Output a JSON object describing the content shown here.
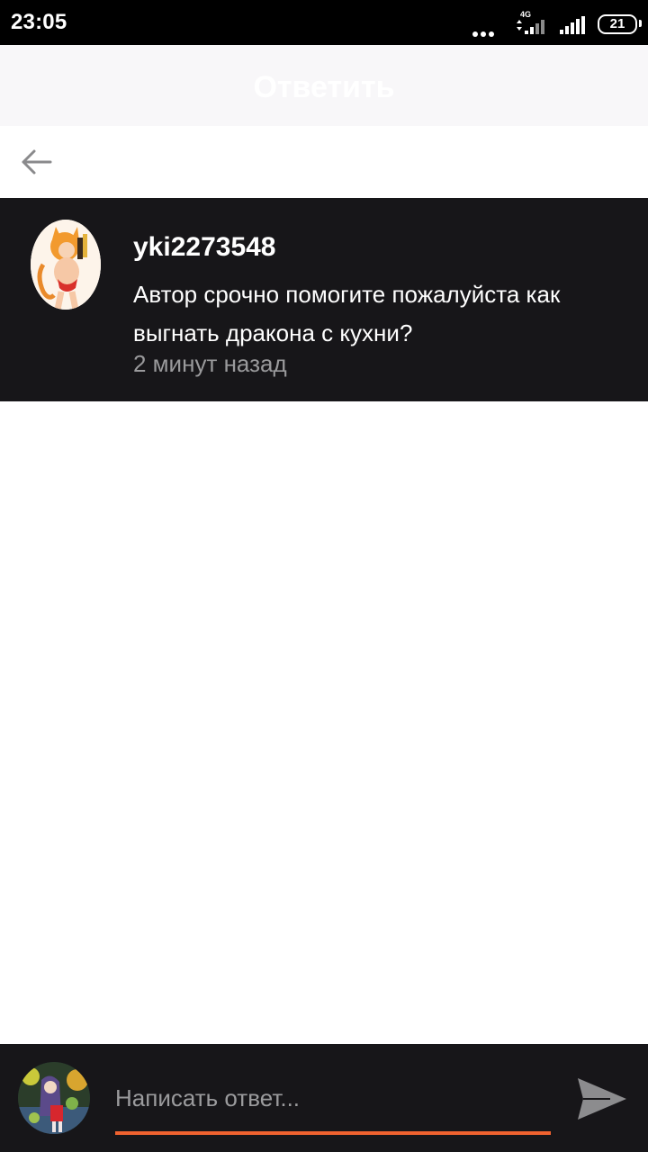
{
  "status_bar": {
    "time": "23:05",
    "network": "4G",
    "battery": "21"
  },
  "header": {
    "title": "Ответить"
  },
  "nav": {
    "back_icon": "arrow-left-icon"
  },
  "comment": {
    "username": "yki2273548",
    "text": "Автор срочно помогите пожалуйста как выгнать дракона с кухни?",
    "time": "2 минут назад"
  },
  "reply": {
    "placeholder": "Написать ответ...",
    "send_icon": "send-icon"
  },
  "colors": {
    "card_background": "#171619",
    "accent": "#f0622f",
    "muted_text": "#9a9a9c"
  }
}
